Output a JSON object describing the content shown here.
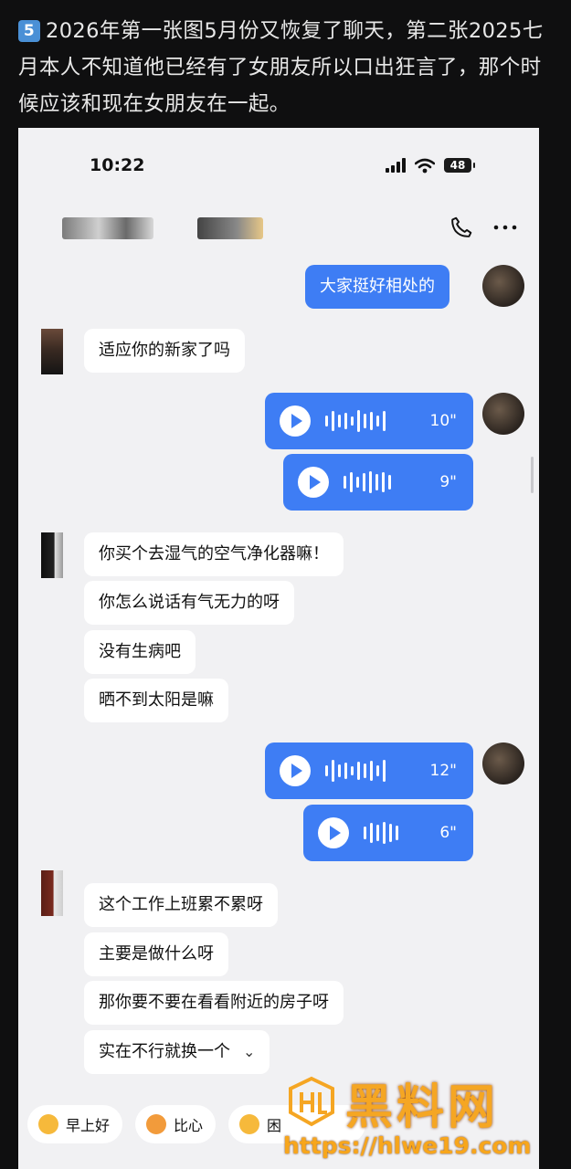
{
  "caption": {
    "badge": "5",
    "text": "2026年第一张图5月份又恢复了聊天，第二张2025七月本人不知道他已经有了女朋友所以口出狂言了，那个时候应该和现在女朋友在一起。"
  },
  "status_bar": {
    "time": "10:22",
    "battery": "48"
  },
  "header": {
    "call_icon": "phone-icon",
    "more_icon": "more-icon"
  },
  "messages": [
    {
      "side": "out",
      "type": "text",
      "text": "大家挺好相处的"
    },
    {
      "side": "in",
      "type": "text",
      "text": "适应你的新家了吗"
    },
    {
      "side": "out",
      "type": "voice",
      "duration": "10\""
    },
    {
      "side": "out",
      "type": "voice",
      "duration": "9\""
    },
    {
      "side": "in",
      "type": "text",
      "text": "你买个去湿气的空气净化器嘛！"
    },
    {
      "side": "in",
      "type": "text",
      "text": "你怎么说话有气无力的呀"
    },
    {
      "side": "in",
      "type": "text",
      "text": "没有生病吧"
    },
    {
      "side": "in",
      "type": "text",
      "text": "晒不到太阳是嘛"
    },
    {
      "side": "out",
      "type": "voice",
      "duration": "12\""
    },
    {
      "side": "out",
      "type": "voice",
      "duration": "6\""
    },
    {
      "side": "in",
      "type": "text",
      "text": "这个工作上班累不累呀"
    },
    {
      "side": "in",
      "type": "text",
      "text": "主要是做什么呀"
    },
    {
      "side": "in",
      "type": "text",
      "text": "那你要不要在看看附近的房子呀"
    },
    {
      "side": "in",
      "type": "text",
      "text": "实在不行就换一个"
    }
  ],
  "quick_replies": [
    "早上好",
    "比心",
    "困"
  ],
  "watermark": {
    "name": "黑料网",
    "url": "https://hlwe19.com"
  },
  "colors": {
    "outgoing": "#3e7df4",
    "incoming": "#ffffff",
    "background": "#f1f1f3"
  }
}
